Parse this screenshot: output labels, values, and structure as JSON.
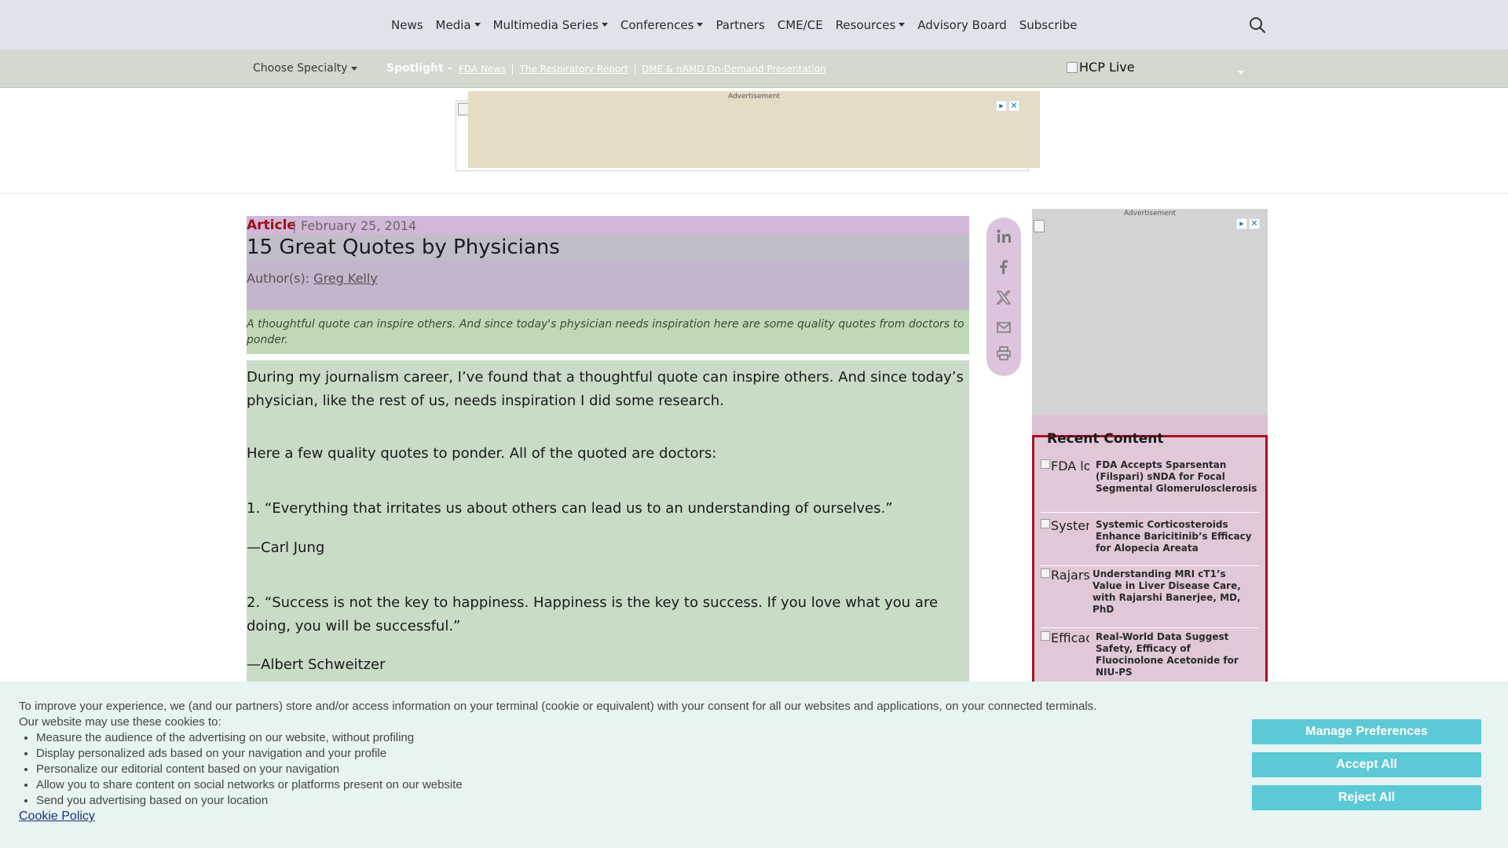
{
  "nav": {
    "items": [
      {
        "label": "News",
        "dropdown": false
      },
      {
        "label": "Media",
        "dropdown": true
      },
      {
        "label": "Multimedia Series",
        "dropdown": true
      },
      {
        "label": "Conferences",
        "dropdown": true
      },
      {
        "label": "Partners",
        "dropdown": false
      },
      {
        "label": "CME/CE",
        "dropdown": false
      },
      {
        "label": "Resources",
        "dropdown": true
      },
      {
        "label": "Advisory Board",
        "dropdown": false
      },
      {
        "label": "Subscribe",
        "dropdown": false
      }
    ],
    "search_icon": "search-icon"
  },
  "subbar": {
    "specialty_label": "Choose Specialty",
    "spotlight_label": "Spotlight -",
    "links": [
      "FDA News",
      "The Respiratory Report",
      "DME & nAMD On-Demand Presentation"
    ],
    "logo_alt": "HCP Live"
  },
  "ads": {
    "label": "Advertisement"
  },
  "article": {
    "type": "Article",
    "date": "February 25, 2014",
    "title": "15 Great Quotes by Physicians",
    "author_prefix": "Author(s):",
    "author": "Greg Kelly",
    "summary": "A thoughtful quote can inspire others. And since today's physician needs inspiration here are some quality quotes from doctors to ponder.",
    "paragraphs": [
      "During my journalism career, I’ve found that a thoughtful quote can inspire others. And since today’s physician, like the rest of us, needs inspiration I did some research.",
      "Here a few quality quotes to ponder. All of the quoted are doctors:",
      "1. “Everything that irritates us about others can lead us to an understanding of ourselves.”",
      "—Carl Jung",
      "2. “Success is not the key to happiness. Happiness is the key to success. If you love what you are doing, you will be successful.”",
      "—Albert Schweitzer"
    ]
  },
  "share": [
    "linkedin-icon",
    "facebook-icon",
    "x-icon",
    "email-icon",
    "print-icon"
  ],
  "recent": {
    "heading": "Recent Content",
    "items": [
      {
        "thumb_alt": "FDA logo | ",
        "title": "FDA Accepts Sparsentan (Filspari) sNDA for Focal Segmental Glomerulosclerosis"
      },
      {
        "thumb_alt": "Systemi",
        "title": "Systemic Corticosteroids Enhance Baricitinib’s Efficacy for Alopecia Areata"
      },
      {
        "thumb_alt": "Rajarsh",
        "title": "Understanding MRI cT1’s Value in Liver Disease Care, with Rajarshi Banerjee, MD, PhD"
      },
      {
        "thumb_alt": "Efficacy",
        "title": "Real-World Data Suggest Safety, Efficacy of Fluocinolone Acetonide for NIU-PS"
      }
    ]
  },
  "cookie": {
    "intro": "To improve your experience, we (and our partners) store and/or access information on your terminal (cookie or equivalent) with your consent for all our websites and applications, on your connected terminals.",
    "intro2": "Our website may use these cookies to:",
    "bullets": [
      "Measure the audience of the advertising on our website, without profiling",
      "Display personalized ads based on your navigation and your profile",
      "Personalize our editorial content based on your navigation",
      "Allow you to share content on social networks or platforms present on our website",
      "Send you advertising based on your location"
    ],
    "policy_link": "Cookie Policy",
    "buttons": {
      "manage": "Manage Preferences",
      "accept": "Accept All",
      "reject": "Reject All"
    },
    "button_color": "#5cc9d6"
  }
}
